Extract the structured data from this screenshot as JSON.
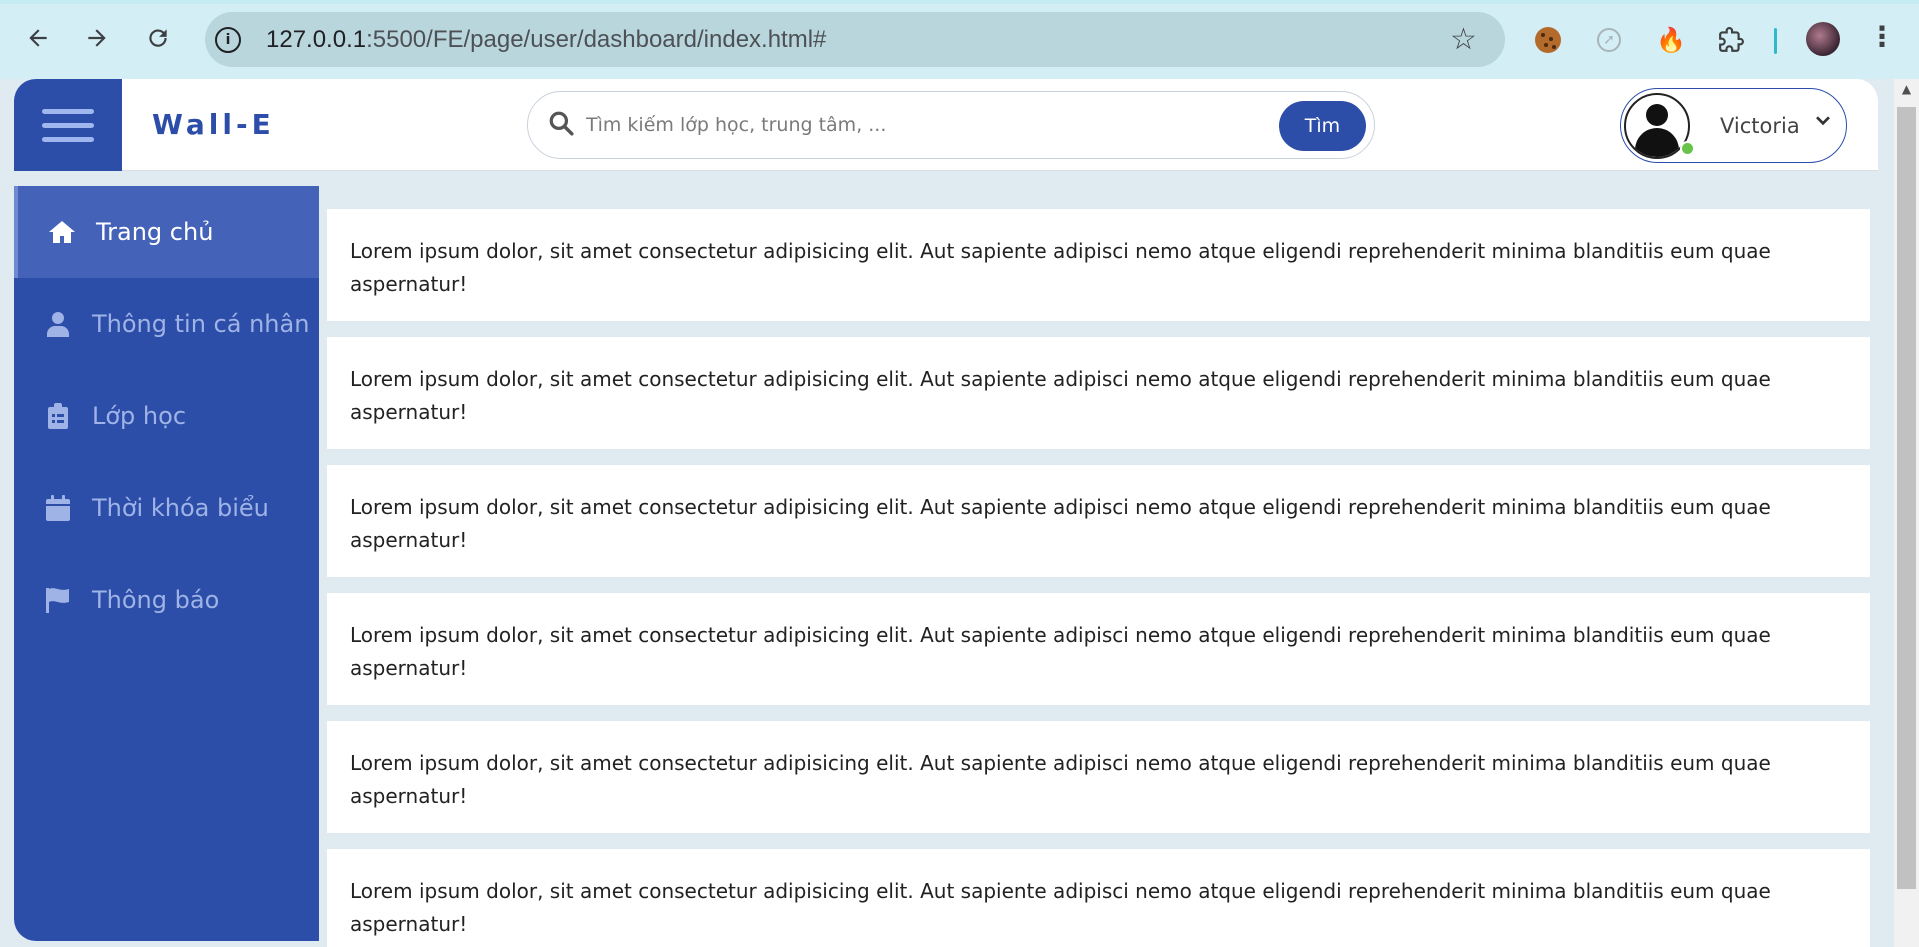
{
  "browser": {
    "url_host": "127.0.0.1",
    "url_rest": ":5500/FE/page/user/dashboard/index.html#"
  },
  "header": {
    "brand": "Wall-E",
    "search_placeholder": "Tìm kiếm lớp học, trung tâm, ...",
    "search_button": "Tìm",
    "user_name": "Victoria"
  },
  "sidebar": {
    "items": [
      {
        "label": "Trang chủ",
        "icon": "home-icon",
        "active": true
      },
      {
        "label": "Thông tin cá nhân",
        "icon": "user-icon",
        "active": false
      },
      {
        "label": "Lớp học",
        "icon": "clipboard-icon",
        "active": false
      },
      {
        "label": "Thời khóa biểu",
        "icon": "calendar-icon",
        "active": false
      },
      {
        "label": "Thông báo",
        "icon": "flag-icon",
        "active": false
      }
    ]
  },
  "main": {
    "cards": [
      {
        "text": "Lorem ipsum dolor, sit amet consectetur adipisicing elit. Aut sapiente adipisci nemo atque eligendi reprehenderit minima blanditiis eum quae aspernatur!"
      },
      {
        "text": "Lorem ipsum dolor, sit amet consectetur adipisicing elit. Aut sapiente adipisci nemo atque eligendi reprehenderit minima blanditiis eum quae aspernatur!"
      },
      {
        "text": "Lorem ipsum dolor, sit amet consectetur adipisicing elit. Aut sapiente adipisci nemo atque eligendi reprehenderit minima blanditiis eum quae aspernatur!"
      },
      {
        "text": "Lorem ipsum dolor, sit amet consectetur adipisicing elit. Aut sapiente adipisci nemo atque eligendi reprehenderit minima blanditiis eum quae aspernatur!"
      },
      {
        "text": "Lorem ipsum dolor, sit amet consectetur adipisicing elit. Aut sapiente adipisci nemo atque eligendi reprehenderit minima blanditiis eum quae aspernatur!"
      },
      {
        "text": "Lorem ipsum dolor, sit amet consectetur adipisicing elit. Aut sapiente adipisci nemo atque eligendi reprehenderit minima blanditiis eum quae aspernatur!"
      }
    ]
  },
  "colors": {
    "primary": "#2d4ea8",
    "sidebar_active": "#4463b8",
    "page_bg": "#dfeaf1",
    "online": "#69c24a"
  }
}
